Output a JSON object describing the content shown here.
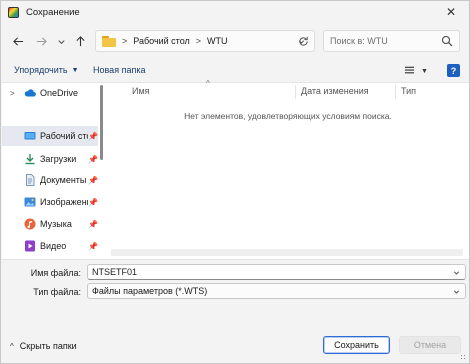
{
  "window": {
    "title": "Сохранение",
    "close_glyph": "✕"
  },
  "nav": {
    "back_icon": "arrow-left-icon",
    "forward_icon": "arrow-right-icon",
    "recent_icon": "chevron-down-icon",
    "up_icon": "arrow-up-icon",
    "breadcrumb": [
      "Рабочий стол",
      "WTU"
    ],
    "breadcrumb_sep": ">",
    "search_placeholder": "Поиск в: WTU"
  },
  "commands": {
    "organize_label": "Упорядочить",
    "new_folder_label": "Новая папка"
  },
  "sidebar": {
    "items": [
      {
        "label": "OneDrive",
        "icon": "cloud-icon",
        "expander": ">",
        "pinned": false,
        "selected": false
      },
      {
        "label": "Рабочий стол",
        "icon": "desktop-icon",
        "pinned": true,
        "selected": true
      },
      {
        "label": "Загрузки",
        "icon": "download-icon",
        "pinned": true,
        "selected": false
      },
      {
        "label": "Документы",
        "icon": "document-icon",
        "pinned": true,
        "selected": false
      },
      {
        "label": "Изображения",
        "icon": "pictures-icon",
        "pinned": true,
        "selected": false
      },
      {
        "label": "Музыка",
        "icon": "music-icon",
        "pinned": true,
        "selected": false
      },
      {
        "label": "Видео",
        "icon": "video-icon",
        "pinned": true,
        "selected": false
      }
    ]
  },
  "file_list": {
    "columns": [
      "Имя",
      "Дата изменения",
      "Тип"
    ],
    "empty_message": "Нет элементов, удовлетворяющих условиям поиска."
  },
  "form": {
    "filename_label": "Имя файла:",
    "filename_value": "NTSETF01",
    "filetype_label": "Тип файла:",
    "filetype_value": "Файлы параметров (*.WTS)"
  },
  "footer": {
    "hide_folders_label": "Скрыть папки",
    "save_label": "Сохранить",
    "cancel_label": "Отмена"
  },
  "colors": {
    "accent": "#2e6ad4",
    "selection": "#e5e9ef",
    "command_text": "#1a3f6e"
  }
}
